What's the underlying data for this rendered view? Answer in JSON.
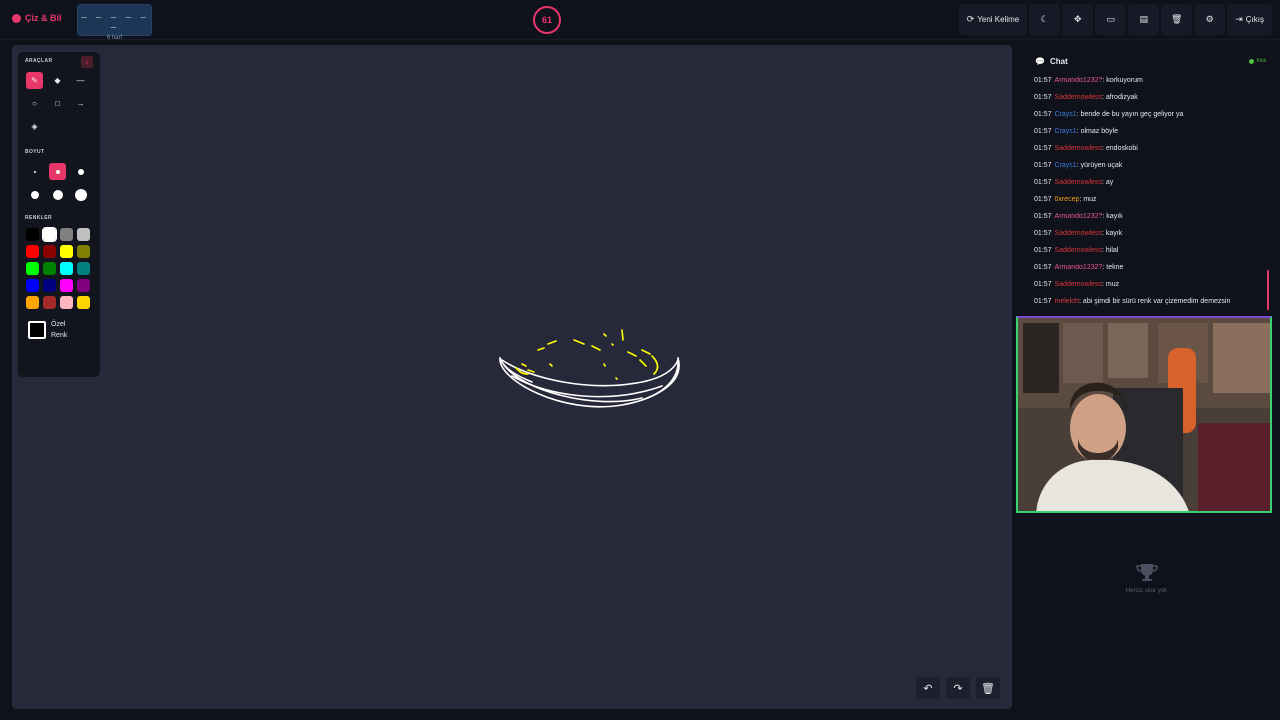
{
  "header": {
    "logo_text": "Çiz & Bil",
    "word_mask": "– – – – – –",
    "letter_count": "6 harf",
    "timer": "61",
    "buttons": {
      "new_word": "Yeni Kelime",
      "exit": "Çıkış"
    }
  },
  "tools": {
    "tools_header": "ARAÇLAR",
    "size_header": "BOYUT",
    "colors_header": "RENKLER",
    "custom_color_line1": "Özel",
    "custom_color_line2": "Renk",
    "colors": [
      "#000000",
      "#ffffff",
      "#808080",
      "#c0c0c0",
      "#ff0000",
      "#8b0000",
      "#ffff00",
      "#808000",
      "#00ff00",
      "#008000",
      "#00ffff",
      "#008080",
      "#0000ff",
      "#000080",
      "#ff00ff",
      "#800080",
      "#ffa500",
      "#a52a2a",
      "#ffb6c1",
      "#ffd700"
    ]
  },
  "chat": {
    "title": "Chat",
    "platform": "Kick",
    "messages": [
      {
        "time": "01:57",
        "user": "Armando1232?",
        "color": "#e85a8a",
        "text": ": korkuyorum"
      },
      {
        "time": "01:57",
        "user": "Saddemowless",
        "color": "#d63a3a",
        "text": ": afrodizyak"
      },
      {
        "time": "01:57",
        "user": "Crays1",
        "color": "#3a7fe0",
        "text": ": bende de bu yayın geç geliyor ya"
      },
      {
        "time": "01:57",
        "user": "Crays1",
        "color": "#3a7fe0",
        "text": ": olmaz böyle"
      },
      {
        "time": "01:57",
        "user": "Saddemowless",
        "color": "#d63a3a",
        "text": ": endoskobi"
      },
      {
        "time": "01:57",
        "user": "Crays1",
        "color": "#3a7fe0",
        "text": ": yürüyen uçak"
      },
      {
        "time": "01:57",
        "user": "Saddemowless",
        "color": "#d63a3a",
        "text": ": ay"
      },
      {
        "time": "01:57",
        "user": "0xrecep",
        "color": "#f0a020",
        "text": ": muz"
      },
      {
        "time": "01:57",
        "user": "Armando1232?",
        "color": "#e85a8a",
        "text": ": kayık"
      },
      {
        "time": "01:57",
        "user": "Saddemowless",
        "color": "#d63a3a",
        "text": ": kayık"
      },
      {
        "time": "01:57",
        "user": "Saddemowless",
        "color": "#d63a3a",
        "text": ": hilal"
      },
      {
        "time": "01:57",
        "user": "Armando1232?",
        "color": "#e85a8a",
        "text": ": tekne"
      },
      {
        "time": "01:57",
        "user": "Saddemowless",
        "color": "#d63a3a",
        "text": ": muz"
      },
      {
        "time": "01:57",
        "user": "melekth",
        "color": "#d63a3a",
        "text": ": abi şimdi bir sürü renk var çizemedim demezsin"
      }
    ]
  },
  "scores": {
    "empty_text": "Henüz skor yok"
  },
  "accent_color": "#e8386a"
}
